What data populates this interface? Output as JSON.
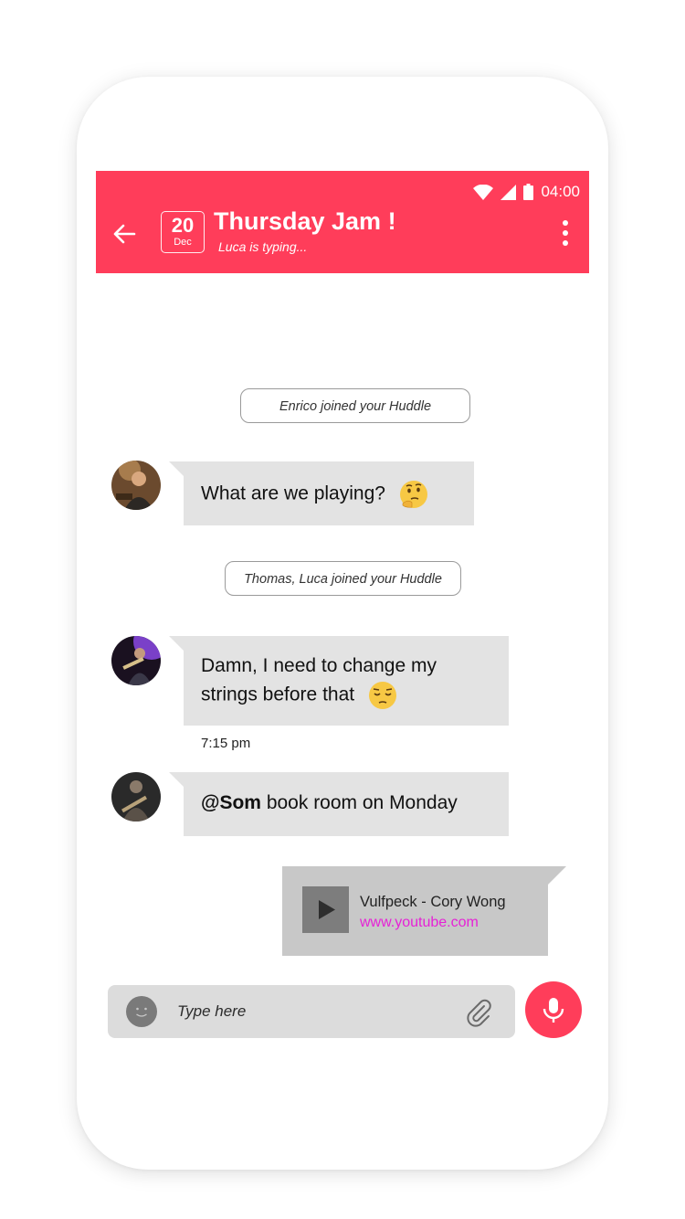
{
  "status_bar": {
    "time": "04:00"
  },
  "header": {
    "title": "Thursday Jam !",
    "subtitle": "Luca is typing...",
    "date_day": "20",
    "date_month": "Dec",
    "accent_color": "#ff3d5a"
  },
  "messages": {
    "sys_1": "Enrico joined your Huddle",
    "msg_1": {
      "text": "What are we playing?",
      "emoji": "thinking-face"
    },
    "sys_2": "Thomas, Luca joined your Huddle",
    "msg_2": {
      "line1": "Damn, I need to change my",
      "line2": "strings before that",
      "emoji": "pensive-face",
      "time": "7:15 pm"
    },
    "msg_3": {
      "mention": "@Som",
      "text": " book room on Monday"
    },
    "link": {
      "title": "Vulfpeck - Cory Wong",
      "url": "www.youtube.com"
    }
  },
  "composer": {
    "placeholder": "Type here"
  }
}
